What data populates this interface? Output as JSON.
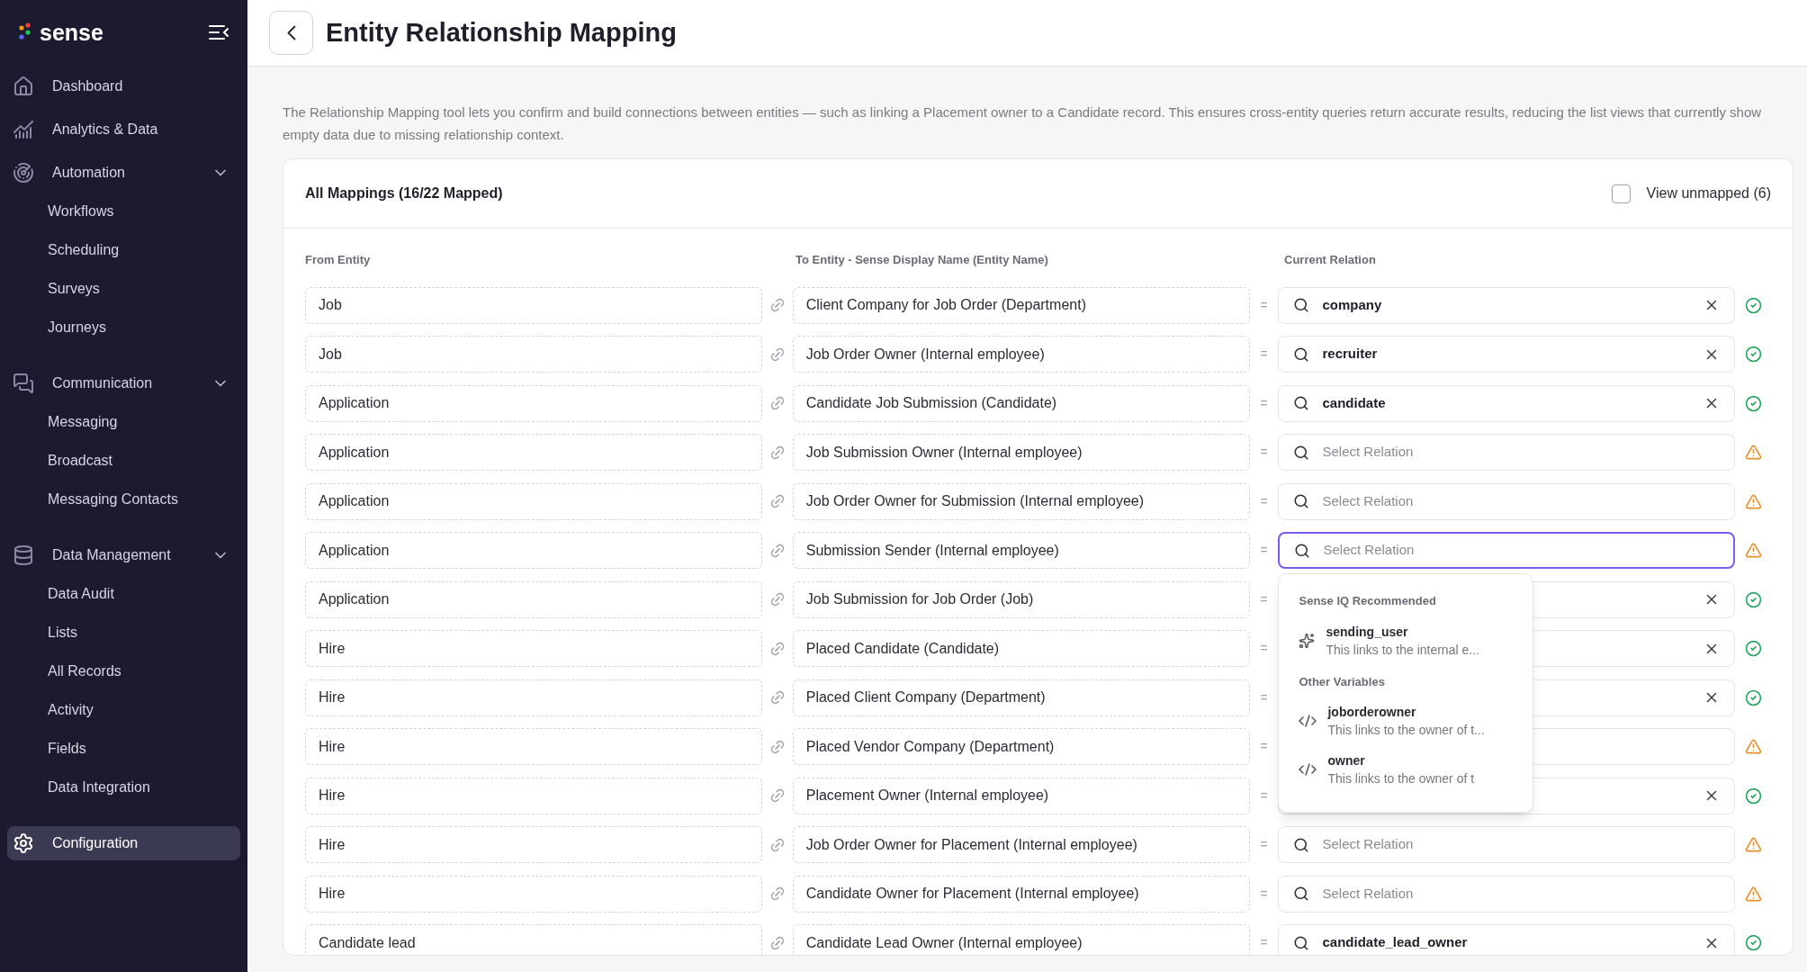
{
  "sidebar": {
    "logo": "sense",
    "items": [
      {
        "label": "Dashboard",
        "selected": false
      },
      {
        "label": "Analytics & Data",
        "selected": false
      },
      {
        "label": "Automation",
        "selected": false,
        "expanded": true,
        "children": [
          {
            "label": "Workflows",
            "selected": false
          },
          {
            "label": "Scheduling",
            "selected": false
          },
          {
            "label": "Surveys",
            "selected": false
          },
          {
            "label": "Journeys",
            "selected": false
          }
        ]
      },
      {
        "label": "Communication",
        "selected": false,
        "expanded": true,
        "children": [
          {
            "label": "Messaging",
            "selected": false
          },
          {
            "label": "Broadcast",
            "selected": false
          },
          {
            "label": "Messaging Contacts",
            "selected": false
          }
        ]
      },
      {
        "label": "Data Management",
        "selected": false,
        "expanded": true,
        "children": [
          {
            "label": "Data Audit",
            "selected": false
          },
          {
            "label": "Lists",
            "selected": false
          },
          {
            "label": "All Records",
            "selected": false
          },
          {
            "label": "Activity",
            "selected": false
          },
          {
            "label": "Fields",
            "selected": false
          },
          {
            "label": "Data Integration",
            "selected": false
          }
        ]
      },
      {
        "label": "Configuration",
        "selected": true
      }
    ]
  },
  "header": {
    "title": "Entity Relationship Mapping"
  },
  "description": "The Relationship Mapping tool lets you confirm and build connections between entities — such as linking a Placement owner to a Candidate record. This ensures cross-entity queries return accurate results, reducing the list views that currently show empty data due to missing relationship context.",
  "card": {
    "title": "All Mappings (16/22 Mapped)",
    "view_unmapped": {
      "label": "View unmapped (6)",
      "checked": false
    },
    "columns": [
      "From Entity",
      "To Entity - Sense Display Name (Entity Name)",
      "Current Relation"
    ],
    "rows": [
      {
        "from": "Job",
        "to": "Client Company for Job Order (Department)",
        "equals": "=",
        "value": "company",
        "mapped": true,
        "focused": false
      },
      {
        "from": "Job",
        "to": "Job Order Owner (Internal employee)",
        "equals": "=",
        "value": "recruiter",
        "mapped": true,
        "focused": false
      },
      {
        "from": "Application",
        "to": "Candidate Job Submission (Candidate)",
        "equals": "=",
        "value": "candidate",
        "mapped": true,
        "focused": false
      },
      {
        "from": "Application",
        "to": "Job Submission Owner (Internal employee)",
        "equals": "=",
        "placeholder": "Select Relation",
        "mapped": false,
        "focused": false
      },
      {
        "from": "Application",
        "to": "Job Order Owner for Submission (Internal employee)",
        "equals": "=",
        "placeholder": "Select Relation",
        "mapped": false,
        "focused": false
      },
      {
        "from": "Application",
        "to": "Submission Sender (Internal employee)",
        "equals": "=",
        "placeholder": "Select Relation",
        "mapped": false,
        "focused": true
      },
      {
        "from": "Application",
        "to": "Job Submission for Job Order (Job)",
        "equals": "=",
        "mapped": true,
        "focused": false
      },
      {
        "from": "Hire",
        "to": "Placed Candidate (Candidate)",
        "equals": "=",
        "mapped": true,
        "focused": false
      },
      {
        "from": "Hire",
        "to": "Placed Client Company (Department)",
        "equals": "=",
        "mapped": true,
        "focused": false
      },
      {
        "from": "Hire",
        "to": "Placed Vendor Company (Department)",
        "equals": "=",
        "mapped": false,
        "focused": false
      },
      {
        "from": "Hire",
        "to": "Placement Owner (Internal employee)",
        "equals": "=",
        "mapped": true,
        "focused": false
      },
      {
        "from": "Hire",
        "to": "Job Order Owner for Placement (Internal employee)",
        "equals": "=",
        "placeholder": "Select Relation",
        "mapped": false,
        "focused": false
      },
      {
        "from": "Hire",
        "to": "Candidate Owner for Placement (Internal employee)",
        "equals": "=",
        "placeholder": "Select Relation",
        "mapped": false,
        "focused": false
      },
      {
        "from": "Candidate lead",
        "to": "Candidate Lead Owner (Internal employee)",
        "equals": "=",
        "value": "candidate_lead_owner",
        "mapped": true,
        "focused": false
      }
    ],
    "dropdown": {
      "sections": [
        {
          "heading": "Sense IQ Recommended",
          "options": [
            {
              "kind": "recommended",
              "name": "sending_user",
              "description": "This links to the internal e..."
            }
          ]
        },
        {
          "heading": "Other Variables",
          "options": [
            {
              "kind": "variable",
              "name": "joborderowner",
              "description": "This links to the owner of t..."
            },
            {
              "kind": "variable",
              "name": "owner",
              "description": "This links to the owner of t"
            }
          ]
        }
      ]
    }
  }
}
